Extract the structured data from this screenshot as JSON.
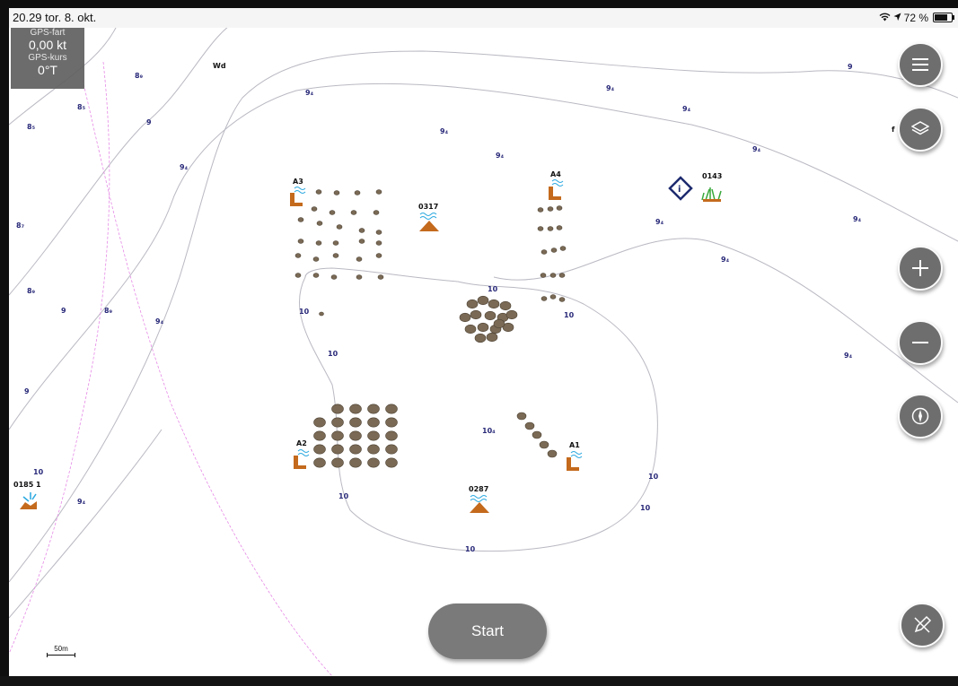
{
  "status_bar": {
    "time_date": "20.29  tor. 8. okt.",
    "battery": "72 %"
  },
  "gps_panel": {
    "speed_label": "GPS-fart",
    "speed_value": "0,00 kt",
    "course_label": "GPS-kurs",
    "course_value": "0°T"
  },
  "map": {
    "seamarks": [
      "A3",
      "A4",
      "0317",
      "0143",
      "A2",
      "A1",
      "0287",
      "0185 1"
    ],
    "area_label": "Wd",
    "f_label": "f",
    "scale_label": "50m",
    "depth_labels": [
      "10",
      "10",
      "10",
      "10",
      "10",
      "10",
      "10",
      "10",
      "10",
      "10₄",
      "9",
      "9",
      "9",
      "9",
      "9",
      "9",
      "9₄",
      "9₄",
      "9₄",
      "9₄",
      "9₄",
      "9₄",
      "9₄",
      "9₄",
      "9₄",
      "9₄",
      "9₄",
      "9₄",
      "9₄",
      "8₉",
      "8₅",
      "8₅",
      "8₇",
      "8₉",
      "8₉"
    ]
  },
  "buttons": {
    "start_label": "Start"
  },
  "icons": [
    "menu-icon",
    "layers-icon",
    "zoom-in-icon",
    "zoom-out-icon",
    "compass-icon",
    "edit-route-icon",
    "wifi-icon",
    "location-arrow-icon",
    "battery-icon",
    "info-diamond-icon",
    "seagrass-icon",
    "buoy-icon",
    "rock-icon"
  ]
}
